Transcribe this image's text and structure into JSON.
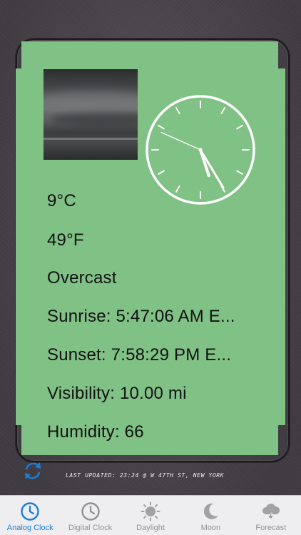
{
  "weather": {
    "celsius": "9°C",
    "fahrenheit": "49°F",
    "condition": "Overcast",
    "sunrise": "Sunrise: 5:47:06 AM E...",
    "sunset": "Sunset: 7:58:29 PM E...",
    "visibility": "Visibility: 10.00 mi",
    "humidity": "Humidity: 66"
  },
  "clock": {
    "hour": 5,
    "minute": 24,
    "second": 49,
    "face_color": "#ffffff"
  },
  "footer": {
    "last_updated": "Last Updated: 23:24 @ W 47th St, New York"
  },
  "tabs": [
    {
      "label": "Analog Clock",
      "icon": "analog-clock-icon",
      "active": true
    },
    {
      "label": "Digital Clock",
      "icon": "digital-clock-icon",
      "active": false
    },
    {
      "label": "Daylight",
      "icon": "sun-icon",
      "active": false
    },
    {
      "label": "Moon",
      "icon": "moon-icon",
      "active": false
    },
    {
      "label": "Forecast",
      "icon": "storm-cloud-icon",
      "active": false
    }
  ],
  "colors": {
    "card": "#80c185",
    "accent": "#1a7ed8",
    "inactive": "#929292"
  }
}
